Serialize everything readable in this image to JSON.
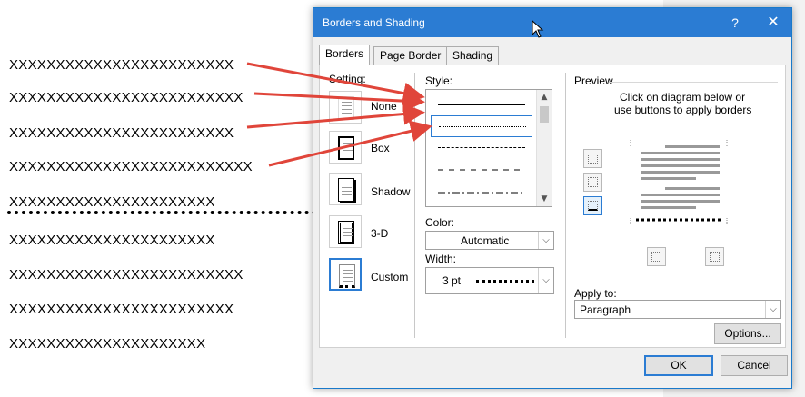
{
  "document": {
    "lines": [
      "XXXXXXXXXXXXXXXXXXXXXXXX",
      "XXXXXXXXXXXXXXXXXXXXXXXXX",
      "XXXXXXXXXXXXXXXXXXXXXXXX",
      "XXXXXXXXXXXXXXXXXXXXXXXXXX",
      "XXXXXXXXXXXXXXXXXXXXXX",
      "XXXXXXXXXXXXXXXXXXXXXX",
      "XXXXXXXXXXXXXXXXXXXXXXXXX",
      "XXXXXXXXXXXXXXXXXXXXXXXX",
      "XXXXXXXXXXXXXXXXXXXXX"
    ]
  },
  "dialog": {
    "title": "Borders and Shading",
    "help_icon": "?",
    "close_icon": "✕",
    "tabs": [
      {
        "label": "Borders",
        "active": true
      },
      {
        "label": "Page Border",
        "active": false
      },
      {
        "label": "Shading",
        "active": false
      }
    ],
    "setting": {
      "label": "Setting:",
      "options": [
        {
          "label": "None",
          "icon": "none-border-icon"
        },
        {
          "label": "Box",
          "icon": "box-border-icon"
        },
        {
          "label": "Shadow",
          "icon": "shadow-border-icon"
        },
        {
          "label": "3-D",
          "icon": "3d-border-icon"
        },
        {
          "label": "Custom",
          "icon": "custom-border-icon",
          "selected": true
        }
      ]
    },
    "style": {
      "label": "Style:",
      "items": [
        "solid",
        "dotted",
        "dashed-small",
        "dashed",
        "dash-dot"
      ],
      "selected_index": 1
    },
    "color": {
      "label": "Color:",
      "value": "Automatic"
    },
    "width": {
      "label": "Width:",
      "value": "3 pt"
    },
    "preview": {
      "label": "Preview",
      "instructions_line1": "Click on diagram below or",
      "instructions_line2": "use buttons to apply borders"
    },
    "apply_to": {
      "label": "Apply to:",
      "value": "Paragraph"
    },
    "buttons": {
      "options": "Options...",
      "ok": "OK",
      "cancel": "Cancel"
    },
    "colors": {
      "titlebar": "#2b7cd3",
      "accent": "#2b7cd3",
      "arrow": "#e0453a"
    }
  }
}
